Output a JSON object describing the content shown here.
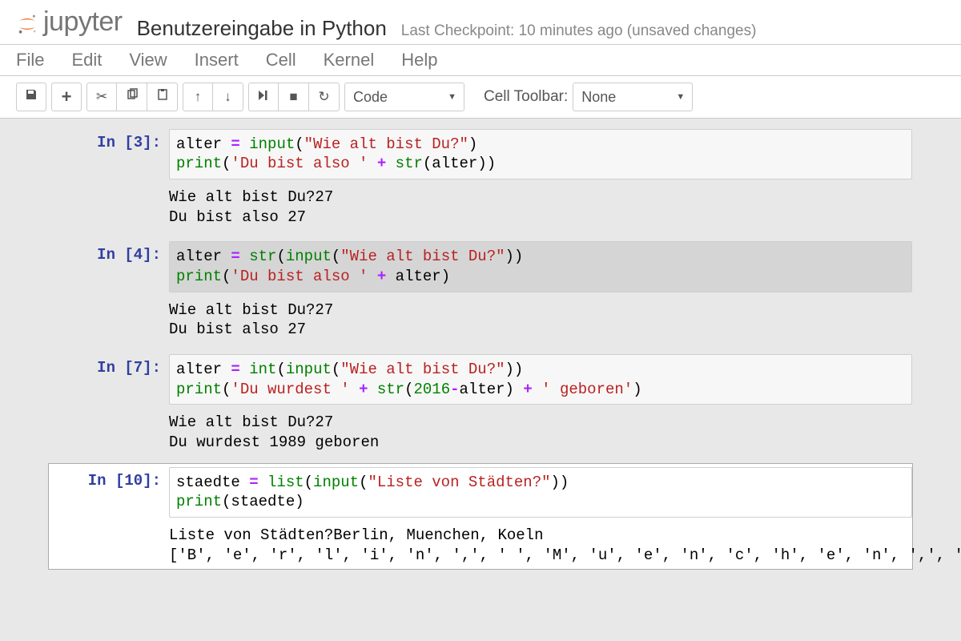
{
  "header": {
    "logo_text": "jupyter",
    "title": "Benutzereingabe in Python",
    "checkpoint": "Last Checkpoint: 10 minutes ago (unsaved changes)"
  },
  "menu": [
    "File",
    "Edit",
    "View",
    "Insert",
    "Cell",
    "Kernel",
    "Help"
  ],
  "toolbar": {
    "cell_type": "Code",
    "cell_toolbar_label": "Cell Toolbar:",
    "cell_toolbar_value": "None"
  },
  "cells": [
    {
      "prompt": "In [3]:",
      "code_tokens": [
        {
          "t": "alter ",
          "c": "nm"
        },
        {
          "t": "=",
          "c": "op"
        },
        {
          "t": " ",
          "c": "nm"
        },
        {
          "t": "input",
          "c": "fn"
        },
        {
          "t": "(",
          "c": "punc"
        },
        {
          "t": "\"Wie alt bist Du?\"",
          "c": "st"
        },
        {
          "t": ")",
          "c": "punc"
        },
        {
          "t": "\n",
          "c": "nm"
        },
        {
          "t": "print",
          "c": "fn"
        },
        {
          "t": "(",
          "c": "punc"
        },
        {
          "t": "'Du bist also '",
          "c": "st"
        },
        {
          "t": " ",
          "c": "nm"
        },
        {
          "t": "+",
          "c": "op"
        },
        {
          "t": " ",
          "c": "nm"
        },
        {
          "t": "str",
          "c": "fn"
        },
        {
          "t": "(",
          "c": "punc"
        },
        {
          "t": "alter",
          "c": "nm"
        },
        {
          "t": "))",
          "c": "punc"
        }
      ],
      "output": "Wie alt bist Du?27\nDu bist also 27"
    },
    {
      "prompt": "In [4]:",
      "cls": "cell4",
      "code_tokens": [
        {
          "t": "alter ",
          "c": "nm"
        },
        {
          "t": "=",
          "c": "op"
        },
        {
          "t": " ",
          "c": "nm"
        },
        {
          "t": "str",
          "c": "fn"
        },
        {
          "t": "(",
          "c": "punc"
        },
        {
          "t": "input",
          "c": "fn"
        },
        {
          "t": "(",
          "c": "punc"
        },
        {
          "t": "\"Wie alt bist Du?\"",
          "c": "st"
        },
        {
          "t": "))",
          "c": "punc"
        },
        {
          "t": "\n",
          "c": "nm"
        },
        {
          "t": "print",
          "c": "fn"
        },
        {
          "t": "(",
          "c": "punc"
        },
        {
          "t": "'Du bist also '",
          "c": "st"
        },
        {
          "t": " ",
          "c": "nm"
        },
        {
          "t": "+",
          "c": "op"
        },
        {
          "t": " alter",
          "c": "nm"
        },
        {
          "t": ")",
          "c": "punc"
        }
      ],
      "output": "Wie alt bist Du?27\nDu bist also 27"
    },
    {
      "prompt": "In [7]:",
      "code_tokens": [
        {
          "t": "alter ",
          "c": "nm"
        },
        {
          "t": "=",
          "c": "op"
        },
        {
          "t": " ",
          "c": "nm"
        },
        {
          "t": "int",
          "c": "fn"
        },
        {
          "t": "(",
          "c": "punc"
        },
        {
          "t": "input",
          "c": "fn"
        },
        {
          "t": "(",
          "c": "punc"
        },
        {
          "t": "\"Wie alt bist Du?\"",
          "c": "st"
        },
        {
          "t": "))",
          "c": "punc"
        },
        {
          "t": "\n",
          "c": "nm"
        },
        {
          "t": "print",
          "c": "fn"
        },
        {
          "t": "(",
          "c": "punc"
        },
        {
          "t": "'Du wurdest '",
          "c": "st"
        },
        {
          "t": " ",
          "c": "nm"
        },
        {
          "t": "+",
          "c": "op"
        },
        {
          "t": " ",
          "c": "nm"
        },
        {
          "t": "str",
          "c": "fn"
        },
        {
          "t": "(",
          "c": "punc"
        },
        {
          "t": "2016",
          "c": "num"
        },
        {
          "t": "-",
          "c": "op"
        },
        {
          "t": "alter",
          "c": "nm"
        },
        {
          "t": ")",
          "c": "punc"
        },
        {
          "t": " ",
          "c": "nm"
        },
        {
          "t": "+",
          "c": "op"
        },
        {
          "t": " ",
          "c": "nm"
        },
        {
          "t": "' geboren'",
          "c": "st"
        },
        {
          "t": ")",
          "c": "punc"
        }
      ],
      "output": "Wie alt bist Du?27\nDu wurdest 1989 geboren"
    },
    {
      "prompt": "In [10]:",
      "selected": true,
      "code_tokens": [
        {
          "t": "staedte ",
          "c": "nm"
        },
        {
          "t": "=",
          "c": "op"
        },
        {
          "t": " ",
          "c": "nm"
        },
        {
          "t": "list",
          "c": "fn"
        },
        {
          "t": "(",
          "c": "punc"
        },
        {
          "t": "input",
          "c": "fn"
        },
        {
          "t": "(",
          "c": "punc"
        },
        {
          "t": "\"Liste von Städten?\"",
          "c": "st"
        },
        {
          "t": "))",
          "c": "punc"
        },
        {
          "t": "\n",
          "c": "nm"
        },
        {
          "t": "print",
          "c": "fn"
        },
        {
          "t": "(",
          "c": "punc"
        },
        {
          "t": "staedte",
          "c": "nm"
        },
        {
          "t": ")",
          "c": "punc"
        }
      ],
      "output": "Liste von Städten?Berlin, Muenchen, Koeln\n['B', 'e', 'r', 'l', 'i', 'n', ',', ' ', 'M', 'u', 'e', 'n', 'c', 'h', 'e', 'n', ',', ' ', 'K', 'o', 'e', 'l', 'n']"
    }
  ]
}
